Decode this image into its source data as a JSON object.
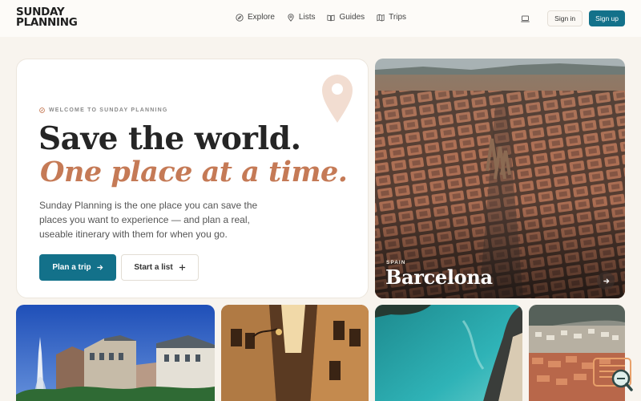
{
  "brand": {
    "line1": "SUNDAY",
    "line2": "PLANNING"
  },
  "nav": [
    {
      "label": "Explore",
      "icon": "compass-icon"
    },
    {
      "label": "Lists",
      "icon": "map-pin-icon"
    },
    {
      "label": "Guides",
      "icon": "book-icon"
    },
    {
      "label": "Trips",
      "icon": "map-icon"
    }
  ],
  "header": {
    "signin_label": "Sign in",
    "signup_label": "Sign up",
    "device_icon": "laptop-icon"
  },
  "hero": {
    "eyebrow": "WELCOME TO SUNDAY PLANNING",
    "title": "Save the world.",
    "subtitle": "One place at a time.",
    "description": "Sunday Planning is the one place you can save the places you want to experience — and plan a real, useable itinerary with them for when you go.",
    "primary_cta": "Plan a trip",
    "secondary_cta": "Start a list"
  },
  "featured": {
    "country": "SPAIN",
    "city": "Barcelona"
  },
  "colors": {
    "accent": "#13718a",
    "terracotta": "#c57a56",
    "background": "#f8f4ee"
  }
}
